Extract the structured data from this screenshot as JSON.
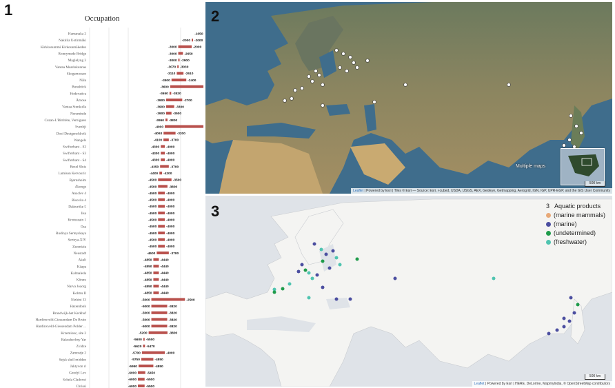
{
  "panel1": {
    "number": "1",
    "title": "Occupation",
    "rows": [
      {
        "name": "Hamanaka 2",
        "start": "-1050",
        "end": "1050",
        "s": -1050,
        "e": 1050
      },
      {
        "name": "Nakkila Uotinmäki",
        "start": "-2000",
        "end": "-2000",
        "s": -2000,
        "e": -2000
      },
      {
        "name": "Kirkkonummi Kirkosnmäkeden",
        "start": "-3000",
        "end": "-2000",
        "s": -3000,
        "e": -2000
      },
      {
        "name": "Ronnymede Bridge",
        "start": "-3000",
        "end": "-2650",
        "s": -3000,
        "e": -2650
      },
      {
        "name": "Maglelyng 3",
        "start": "-3000",
        "end": "-2900",
        "s": -3000,
        "e": -2900
      },
      {
        "name": "Vantaa Maarinkunnas",
        "start": "-3070",
        "end": "-3030",
        "s": -3070,
        "e": -3030
      },
      {
        "name": "Skogsmossen",
        "start": "-3110",
        "end": "-2610",
        "s": -3110,
        "e": -2610
      },
      {
        "name": "Näla",
        "start": "-3500",
        "end": "-2400",
        "s": -3500,
        "e": -2400
      },
      {
        "name": "Bunsböck",
        "start": "-3600",
        "end": "-330",
        "s": -3600,
        "e": -330
      },
      {
        "name": "Hodevatica",
        "start": "-3650",
        "end": "-3520",
        "s": -3650,
        "e": -3520
      },
      {
        "name": "Ämose",
        "start": "-3900",
        "end": "-2700",
        "s": -3900,
        "e": -2700
      },
      {
        "name": "Vantaa Stenkulla",
        "start": "-3900",
        "end": "-3300",
        "s": -3900,
        "e": -3300
      },
      {
        "name": "Norsminde",
        "start": "-3900",
        "end": "-3500",
        "s": -3900,
        "e": -3500
      },
      {
        "name": "Cuzan-L'Birritère, Verniguen",
        "start": "-3950",
        "end": "-3800",
        "s": -3950,
        "e": -3800
      },
      {
        "name": "Svenbji",
        "start": "-4000",
        "end": "-500",
        "s": -4000,
        "e": -500
      },
      {
        "name": "Dool Deutgenchkvik",
        "start": "-4093",
        "end": "-3200",
        "s": -4093,
        "e": -3200
      },
      {
        "name": "Wangels",
        "start": "-4100",
        "end": "-3700",
        "s": -4100,
        "e": -3700
      },
      {
        "name": "Swifterbant - S2",
        "start": "-4300",
        "end": "-4000",
        "s": -4300,
        "e": -4000
      },
      {
        "name": "Swifterbant - S3",
        "start": "-4300",
        "end": "-4000",
        "s": -4300,
        "e": -4000
      },
      {
        "name": "Swifterbant - S4",
        "start": "-4300",
        "end": "-4000",
        "s": -4300,
        "e": -4000
      },
      {
        "name": "Bezel Sluis",
        "start": "-4350",
        "end": "-3700",
        "s": -4350,
        "e": -3700
      },
      {
        "name": "Lamison Kervouric",
        "start": "-4400",
        "end": "-4200",
        "s": -4400,
        "e": -4200
      },
      {
        "name": "Bjørnsholm",
        "start": "-4500",
        "end": "-3500",
        "s": -4500,
        "e": -3500
      },
      {
        "name": "Åkonge",
        "start": "-4500",
        "end": "-3800",
        "s": -4500,
        "e": -3800
      },
      {
        "name": "Anaclev 4",
        "start": "-4500",
        "end": "-4000",
        "s": -4500,
        "e": -4000
      },
      {
        "name": "Bisovka 4",
        "start": "-4500",
        "end": "-4000",
        "s": -4500,
        "e": -4000
      },
      {
        "name": "Dakturöke 5",
        "start": "-4500",
        "end": "-4000",
        "s": -4500,
        "e": -4000
      },
      {
        "name": "Iisa",
        "start": "-4500",
        "end": "-4000",
        "s": -4500,
        "e": -4000
      },
      {
        "name": "Krotuszain 1",
        "start": "-4500",
        "end": "-4000",
        "s": -4500,
        "e": -4000
      },
      {
        "name": "Osa",
        "start": "-4500",
        "end": "-4000",
        "s": -4500,
        "e": -4000
      },
      {
        "name": "Rudinya Serteyskaya",
        "start": "-4500",
        "end": "-4000",
        "s": -4500,
        "e": -4000
      },
      {
        "name": "Serteya-XIV",
        "start": "-4500",
        "end": "-4000",
        "s": -4500,
        "e": -4000
      },
      {
        "name": "Zaesniaia",
        "start": "-4500",
        "end": "-4000",
        "s": -4500,
        "e": -4000
      },
      {
        "name": "Neustadt",
        "start": "-4600",
        "end": "-3700",
        "s": -4600,
        "e": -3700
      },
      {
        "name": "Akali",
        "start": "-4850",
        "end": "-4440",
        "s": -4850,
        "e": -4440
      },
      {
        "name": "Käapa",
        "start": "-4850",
        "end": "-4440",
        "s": -4850,
        "e": -4440
      },
      {
        "name": "Kalmaleda",
        "start": "-4850",
        "end": "-4440",
        "s": -4850,
        "e": -4440
      },
      {
        "name": "Kõnnu",
        "start": "-4850",
        "end": "-4440",
        "s": -4850,
        "e": -4440
      },
      {
        "name": "Narva Joaorg",
        "start": "-4850",
        "end": "-4440",
        "s": -4850,
        "e": -4440
      },
      {
        "name": "Kohtru II",
        "start": "-4850",
        "end": "-4440",
        "s": -4850,
        "e": -4440
      },
      {
        "name": "Nizhini 33",
        "start": "-5000",
        "end": "-2500",
        "s": -5000,
        "e": -2500
      },
      {
        "name": "Hazendonk",
        "start": "-5000",
        "end": "-3820",
        "s": -5000,
        "e": -3820
      },
      {
        "name": "Brandwijk-het Kerkhof",
        "start": "-5000",
        "end": "-3820",
        "s": -5000,
        "e": -3820
      },
      {
        "name": "Hardinxveld-Giessendam De Bruin",
        "start": "-5000",
        "end": "-3820",
        "s": -5000,
        "e": -3820
      },
      {
        "name": "Hardinxveld-Giessendam Polder ...",
        "start": "-5000",
        "end": "-3820",
        "s": -5000,
        "e": -3820
      },
      {
        "name": "Krzemionc, site 2",
        "start": "-5200",
        "end": "-3800",
        "s": -5200,
        "e": -3800
      },
      {
        "name": "Rakushechny Yar",
        "start": "-5600",
        "end": "-5500",
        "s": -5600,
        "e": -5500
      },
      {
        "name": "Zvidze",
        "start": "-5620",
        "end": "-5470",
        "s": -5620,
        "e": -5470
      },
      {
        "name": "Zamostje 2",
        "start": "-5700",
        "end": "-4000",
        "s": -5700,
        "e": -4000
      },
      {
        "name": "Sejsk shell midden",
        "start": "-5750",
        "end": "-4850",
        "s": -5750,
        "e": -4850
      },
      {
        "name": "Jaktyvon ri",
        "start": "-5950",
        "end": "-4850",
        "s": -5950,
        "e": -4850
      },
      {
        "name": "Gondyl Lev",
        "start": "-6000",
        "end": "-5450",
        "s": -6000,
        "e": -5450
      },
      {
        "name": "Schela Cladovei",
        "start": "-6000",
        "end": "-5500",
        "s": -6000,
        "e": -5500
      },
      {
        "name": "Chrissi",
        "start": "-6000",
        "end": "-5500",
        "s": -6000,
        "e": -5500
      }
    ]
  },
  "panel2": {
    "number": "2",
    "multiple_label": "Multiple maps",
    "scale": "500 km",
    "attribution_leaflet": "Leaflet",
    "attribution_rest": "| Powered by Esri | Tiles © Esri — Source: Esri, i-cubed, USDA, USGS, AEX, GeoEye, Getmapping, Aerogrid, IGN, IGP, UPR-EGP, and the GIS User Community"
  },
  "panel3": {
    "number": "3",
    "legend_header_num": "3",
    "legend_header": "Aquatic products",
    "legend": [
      {
        "label": "(marine mammals)",
        "color": "#e8a978"
      },
      {
        "label": "(marine)",
        "color": "#4b4ea0"
      },
      {
        "label": "(undetermined)",
        "color": "#1f9b4b"
      },
      {
        "label": "(freshwater)",
        "color": "#4fc4b0"
      }
    ],
    "scale": "500 km",
    "attribution_leaflet": "Leaflet",
    "attribution_rest": "| Powered by Esri | HERE, DeLorme, MapmyIndia, © OpenStreetMap contributors"
  },
  "colors": {
    "bar": "#b8504c",
    "ocean_sat": "#5d7f99",
    "land_sat": "#8a7a55",
    "ocean_map": "#dfe3e8",
    "land_map": "#f4f4f2"
  }
}
